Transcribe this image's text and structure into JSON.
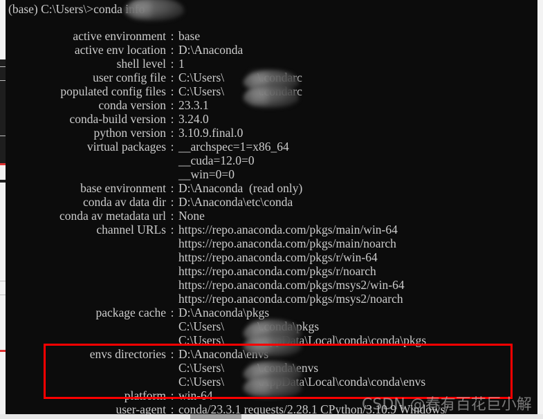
{
  "terminal": {
    "prompt_line": "(base) C:\\Users\\            >conda info",
    "prompt_prefix": "(base) C:\\Users\\",
    "prompt_suffix": ">conda info",
    "command": "conda info",
    "background": "#0c0c0c",
    "foreground": "#cccccc"
  },
  "rows": [
    {
      "key": "active environment",
      "sep": ":",
      "value": "base"
    },
    {
      "key": "active env location",
      "sep": ":",
      "value": "D:\\Anaconda"
    },
    {
      "key": "shell level",
      "sep": ":",
      "value": "1"
    },
    {
      "key": "user config file",
      "sep": ":",
      "value": "C:\\Users\\           \\.condarc"
    },
    {
      "key": "populated config files",
      "sep": ":",
      "value": "C:\\Users\\           \\.condarc"
    },
    {
      "key": "conda version",
      "sep": ":",
      "value": "23.3.1"
    },
    {
      "key": "conda-build version",
      "sep": ":",
      "value": "3.24.0"
    },
    {
      "key": "python version",
      "sep": ":",
      "value": "3.10.9.final.0"
    },
    {
      "key": "virtual packages",
      "sep": ":",
      "value": "__archspec=1=x86_64"
    },
    {
      "key": "",
      "sep": "",
      "value": "__cuda=12.0=0"
    },
    {
      "key": "",
      "sep": "",
      "value": "__win=0=0"
    },
    {
      "key": "base environment",
      "sep": ":",
      "value": "D:\\Anaconda  (read only)"
    },
    {
      "key": "conda av data dir",
      "sep": ":",
      "value": "D:\\Anaconda\\etc\\conda"
    },
    {
      "key": "conda av metadata url",
      "sep": ":",
      "value": "None"
    },
    {
      "key": "channel URLs",
      "sep": ":",
      "value": "https://repo.anaconda.com/pkgs/main/win-64"
    },
    {
      "key": "",
      "sep": "",
      "value": "https://repo.anaconda.com/pkgs/main/noarch"
    },
    {
      "key": "",
      "sep": "",
      "value": "https://repo.anaconda.com/pkgs/r/win-64"
    },
    {
      "key": "",
      "sep": "",
      "value": "https://repo.anaconda.com/pkgs/r/noarch"
    },
    {
      "key": "",
      "sep": "",
      "value": "https://repo.anaconda.com/pkgs/msys2/win-64"
    },
    {
      "key": "",
      "sep": "",
      "value": "https://repo.anaconda.com/pkgs/msys2/noarch"
    },
    {
      "key": "package cache",
      "sep": ":",
      "value": "D:\\Anaconda\\pkgs"
    },
    {
      "key": "",
      "sep": "",
      "value": "C:\\Users\\           \\.conda\\pkgs"
    },
    {
      "key": "",
      "sep": "",
      "value": "C:\\Users\\           \\AppData\\Local\\conda\\conda\\pkgs"
    },
    {
      "key": "envs directories",
      "sep": ":",
      "value": "D:\\Anaconda\\envs"
    },
    {
      "key": "",
      "sep": "",
      "value": "C:\\Users\\           \\.conda\\envs"
    },
    {
      "key": "",
      "sep": "",
      "value": "C:\\Users\\           \\AppData\\Local\\conda\\conda\\envs"
    },
    {
      "key": "platform",
      "sep": ":",
      "value": "win-64"
    },
    {
      "key": "user-agent",
      "sep": ":",
      "value": "conda/23.3.1 requests/2.28.1 CPython/3.10.9 Windows/"
    }
  ],
  "annotation": {
    "highlight_color": "#ff0000",
    "highlight_label": "envs directories highlight box"
  },
  "watermark": {
    "text": "CSDN @春有百花巨小解",
    "color": "#d2d2d2"
  },
  "redaction": {
    "label": "blurred username"
  }
}
